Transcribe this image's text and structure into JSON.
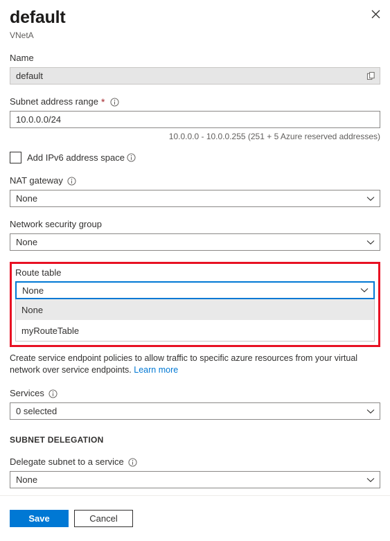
{
  "header": {
    "title": "default",
    "subtitle": "VNetA",
    "close_icon": "close-icon"
  },
  "form": {
    "name": {
      "label": "Name",
      "value": "default",
      "copy_icon": "copy-icon"
    },
    "subnet_address_range": {
      "label": "Subnet address range",
      "required_marker": "*",
      "info_icon": "info-icon",
      "value": "10.0.0.0/24",
      "helper": "10.0.0.0 - 10.0.0.255 (251 + 5 Azure reserved addresses)"
    },
    "ipv6_checkbox": {
      "label": "Add IPv6 address space",
      "checked": false,
      "info_icon": "info-icon"
    },
    "nat_gateway": {
      "label": "NAT gateway",
      "value": "None",
      "info_icon": "info-icon",
      "chevron_icon": "chevron-down-icon"
    },
    "network_security_group": {
      "label": "Network security group",
      "value": "None",
      "chevron_icon": "chevron-down-icon"
    },
    "route_table": {
      "label": "Route table",
      "value": "None",
      "chevron_icon": "chevron-down-icon",
      "expanded": true,
      "highlight_color": "#e81123",
      "focus_color": "#0078d4",
      "options": [
        {
          "label": "None",
          "selected": true
        },
        {
          "label": "myRouteTable",
          "selected": false
        }
      ]
    },
    "service_endpoints": {
      "description_part1": "Create service endpoint policies to allow traffic to specific azure resources from your virtual network over service endpoints.",
      "learn_more": "Learn more"
    },
    "services": {
      "label": "Services",
      "value": "0 selected",
      "info_icon": "info-icon",
      "chevron_icon": "chevron-down-icon"
    },
    "subnet_delegation": {
      "section_title": "SUBNET DELEGATION",
      "delegate": {
        "label": "Delegate subnet to a service",
        "value": "None",
        "info_icon": "info-icon",
        "chevron_icon": "chevron-down-icon"
      }
    }
  },
  "footer": {
    "save_label": "Save",
    "cancel_label": "Cancel",
    "primary_color": "#0078d4"
  }
}
